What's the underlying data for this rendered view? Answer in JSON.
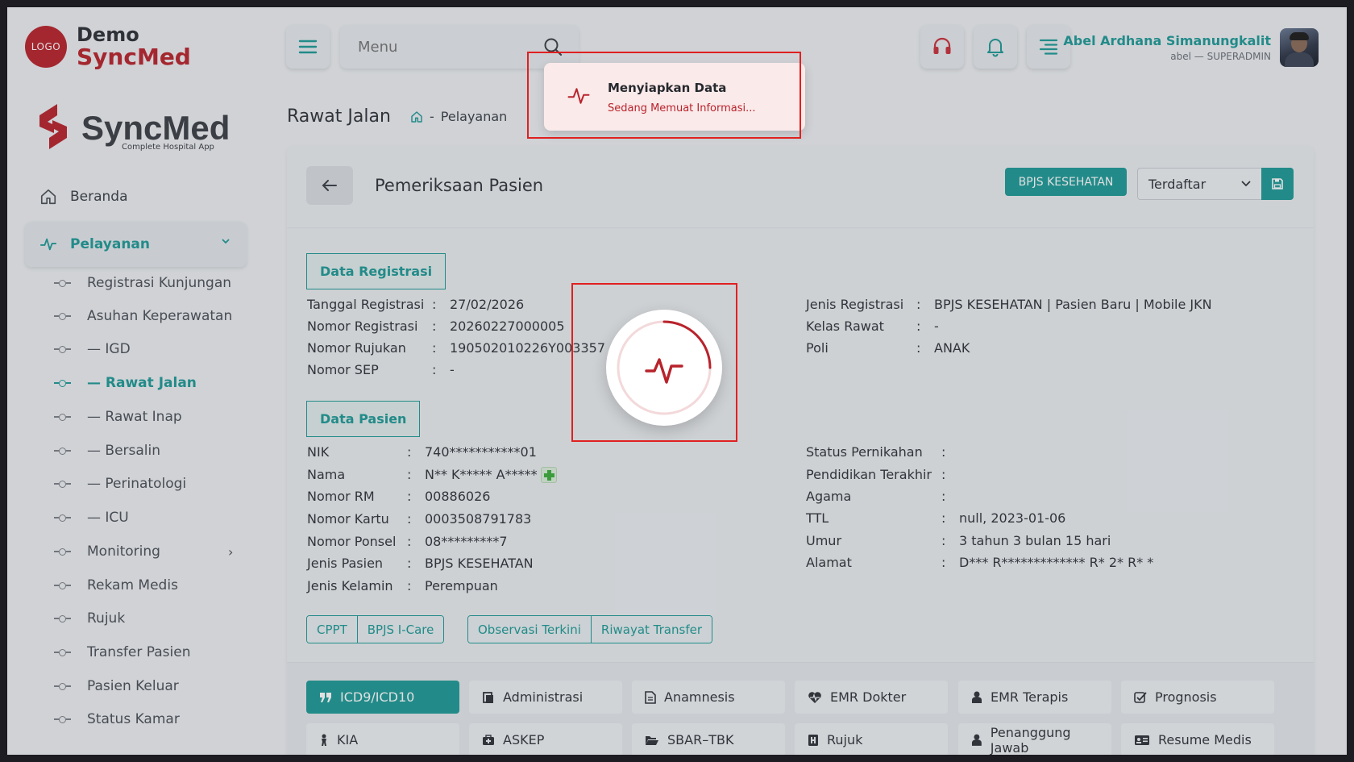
{
  "brand": {
    "logo_text": "LOGO",
    "demo": "Demo",
    "name": "SyncMed",
    "big_name": "SyncMed",
    "tagline": "Complete Hospital App"
  },
  "sidebar": {
    "home": "Beranda",
    "active_group": "Pelayanan",
    "items": [
      {
        "label": "Registrasi Kunjungan"
      },
      {
        "label": "Asuhan Keperawatan"
      },
      {
        "label": "— IGD"
      },
      {
        "label": "— Rawat Jalan"
      },
      {
        "label": "— Rawat Inap"
      },
      {
        "label": "— Bersalin"
      },
      {
        "label": "— Perinatologi"
      },
      {
        "label": "— ICU"
      },
      {
        "label": "Monitoring"
      },
      {
        "label": "Rekam Medis"
      },
      {
        "label": "Rujuk"
      },
      {
        "label": "Transfer Pasien"
      },
      {
        "label": "Pasien Keluar"
      },
      {
        "label": "Status Kamar"
      }
    ]
  },
  "topbar": {
    "search_placeholder": "Menu",
    "user_name": "Abel Ardhana Simanungkalit",
    "user_role": "abel — SUPERADMIN"
  },
  "page": {
    "title": "Rawat Jalan",
    "breadcrumb": "Pelayanan"
  },
  "toast": {
    "title": "Menyiapkan Data",
    "message": "Sedang Memuat Informasi..."
  },
  "card": {
    "title": "Pemeriksaan Pasien",
    "bpjs_button": "BPJS KESEHATAN",
    "status_selected": "Terdaftar"
  },
  "registrasi": {
    "label": "Data Registrasi",
    "left": [
      {
        "k": "Tanggal Registrasi",
        "v": "27/02/2026"
      },
      {
        "k": "Nomor Registrasi",
        "v": "20260227000005"
      },
      {
        "k": "Nomor Rujukan",
        "v": "190502010226Y003357"
      },
      {
        "k": "Nomor SEP",
        "v": "-"
      }
    ],
    "right": [
      {
        "k": "Jenis Registrasi",
        "v": "BPJS KESEHATAN | Pasien Baru | Mobile JKN"
      },
      {
        "k": "Kelas Rawat",
        "v": "-"
      },
      {
        "k": "Poli",
        "v": "ANAK"
      }
    ]
  },
  "pasien": {
    "label": "Data Pasien",
    "left": [
      {
        "k": "NIK",
        "v": "740***********01"
      },
      {
        "k": "Nama",
        "v": "N** K***** A*****"
      },
      {
        "k": "Nomor RM",
        "v": "00886026"
      },
      {
        "k": "Nomor Kartu",
        "v": "0003508791783"
      },
      {
        "k": "Nomor Ponsel",
        "v": "08*********7"
      },
      {
        "k": "Jenis Pasien",
        "v": "BPJS KESEHATAN"
      },
      {
        "k": "Jenis Kelamin",
        "v": "Perempuan"
      }
    ],
    "right": [
      {
        "k": "Status Pernikahan",
        "v": ""
      },
      {
        "k": "Pendidikan Terakhir",
        "v": ""
      },
      {
        "k": "Agama",
        "v": ""
      },
      {
        "k": "TTL",
        "v": "null, 2023-01-06"
      },
      {
        "k": "Umur",
        "v": "3 tahun 3 bulan 15 hari"
      },
      {
        "k": "Alamat",
        "v": "D*** R************* R* 2* R* *"
      }
    ]
  },
  "actions": {
    "group1": [
      "CPPT",
      "BPJS I-Care"
    ],
    "group2": [
      "Observasi Terkini",
      "Riwayat Transfer"
    ]
  },
  "tabs": [
    {
      "label": "ICD9/ICD10",
      "icon": "quote-icon"
    },
    {
      "label": "Administrasi",
      "icon": "clipboard-icon"
    },
    {
      "label": "Anamnesis",
      "icon": "document-icon"
    },
    {
      "label": "EMR Dokter",
      "icon": "heartbeat-icon"
    },
    {
      "label": "EMR Terapis",
      "icon": "user-doctor-icon"
    },
    {
      "label": "Prognosis",
      "icon": "check-square-icon"
    },
    {
      "label": "KIA",
      "icon": "baby-icon"
    },
    {
      "label": "ASKEP",
      "icon": "medkit-icon"
    },
    {
      "label": "SBAR–TBK",
      "icon": "folder-open-icon"
    },
    {
      "label": "Rujuk",
      "icon": "hospital-icon"
    },
    {
      "label": "Penanggung Jawab",
      "icon": "user-icon"
    },
    {
      "label": "Resume Medis",
      "icon": "id-card-icon"
    }
  ],
  "colors": {
    "accent": "#1d9a97",
    "brand_red": "#b8232b",
    "highlight": "#e02020"
  }
}
